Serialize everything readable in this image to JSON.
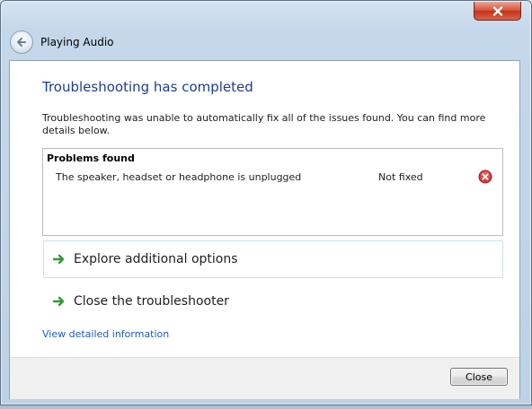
{
  "window": {
    "title": "Playing Audio",
    "close_glyph": "✕"
  },
  "main": {
    "heading": "Troubleshooting has completed",
    "description": "Troubleshooting was unable to automatically fix all of the issues found. You can find more details below."
  },
  "problems": {
    "header": "Problems found",
    "items": [
      {
        "name": "The speaker, headset or headphone is unplugged",
        "status": "Not fixed",
        "icon": "error-icon"
      }
    ]
  },
  "options": [
    {
      "label": "Explore additional options",
      "icon": "green-arrow-icon"
    },
    {
      "label": "Close the troubleshooter",
      "icon": "green-arrow-icon"
    }
  ],
  "link": {
    "label": "View detailed information"
  },
  "footer": {
    "close_button": "Close"
  },
  "colors": {
    "heading": "#1c3e8e",
    "link": "#1e5bb8",
    "arrow": "#2e9b2e",
    "error": "#c8222b"
  }
}
